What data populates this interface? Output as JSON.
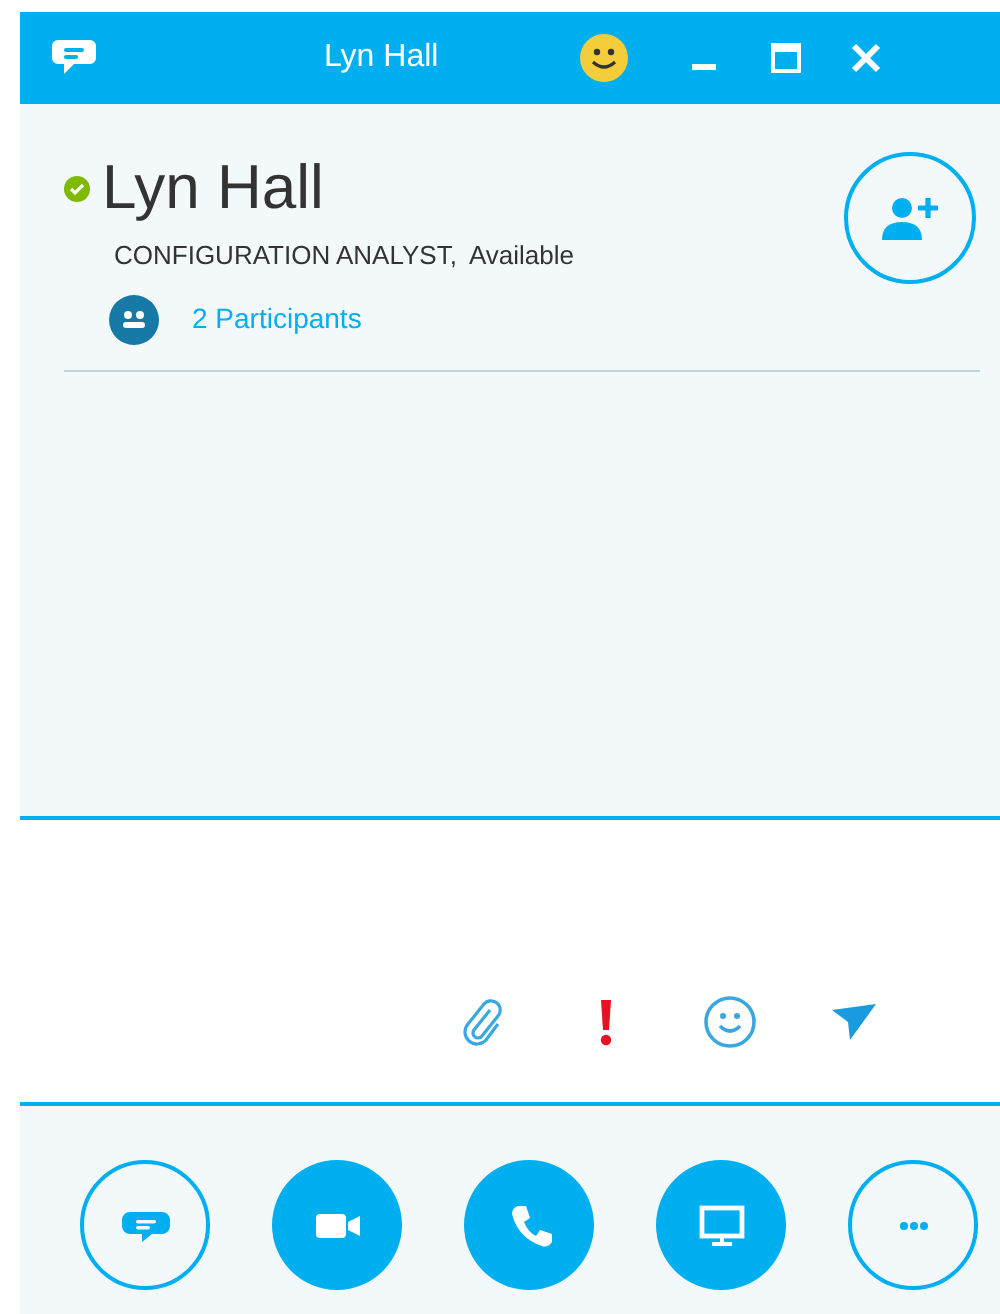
{
  "window": {
    "title": "Lyn Hall"
  },
  "contact": {
    "name": "Lyn Hall",
    "title": "CONFIGURATION ANALYST,",
    "status": "Available",
    "participants": "2 Participants"
  },
  "compose_tools": [
    {
      "kind": "attach"
    },
    {
      "kind": "important"
    },
    {
      "kind": "emoticon"
    },
    {
      "kind": "send"
    }
  ],
  "actions": [
    {
      "kind": "chat",
      "filled": false
    },
    {
      "kind": "video",
      "filled": true
    },
    {
      "kind": "call",
      "filled": true
    },
    {
      "kind": "screen",
      "filled": true
    },
    {
      "kind": "more",
      "filled": false
    }
  ]
}
